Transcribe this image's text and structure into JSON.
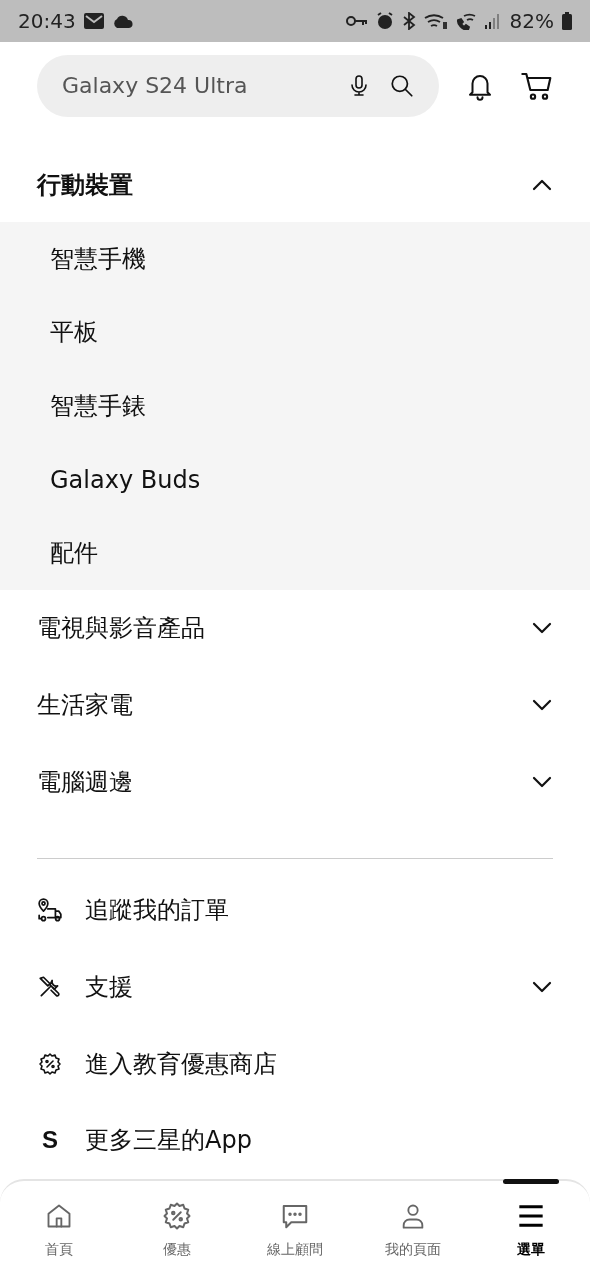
{
  "status_bar": {
    "time": "20:43",
    "battery": "82%"
  },
  "search": {
    "value": "Galaxy S24 Ultra"
  },
  "categories": [
    {
      "label": "行動裝置",
      "expanded": true,
      "children": [
        {
          "label": "智慧手機"
        },
        {
          "label": "平板"
        },
        {
          "label": "智慧手錶"
        },
        {
          "label": "Galaxy Buds"
        },
        {
          "label": "配件"
        }
      ]
    },
    {
      "label": "電視與影音產品",
      "expanded": false
    },
    {
      "label": "生活家電",
      "expanded": false
    },
    {
      "label": "電腦週邊",
      "expanded": false
    }
  ],
  "links": [
    {
      "label": "追蹤我的訂單",
      "kind": "track",
      "expandable": false
    },
    {
      "label": "支援",
      "kind": "support",
      "expandable": true
    },
    {
      "label": "進入教育優惠商店",
      "kind": "offer",
      "expandable": false
    },
    {
      "label": "更多三星的App",
      "kind": "app",
      "expandable": false,
      "icon_text": "S"
    }
  ],
  "nav": [
    {
      "label": "首頁",
      "kind": "home",
      "selected": false
    },
    {
      "label": "優惠",
      "kind": "offer",
      "selected": false
    },
    {
      "label": "線上顧問",
      "kind": "chat",
      "selected": false
    },
    {
      "label": "我的頁面",
      "kind": "person",
      "selected": false
    },
    {
      "label": "選單",
      "kind": "menu",
      "selected": true
    }
  ]
}
